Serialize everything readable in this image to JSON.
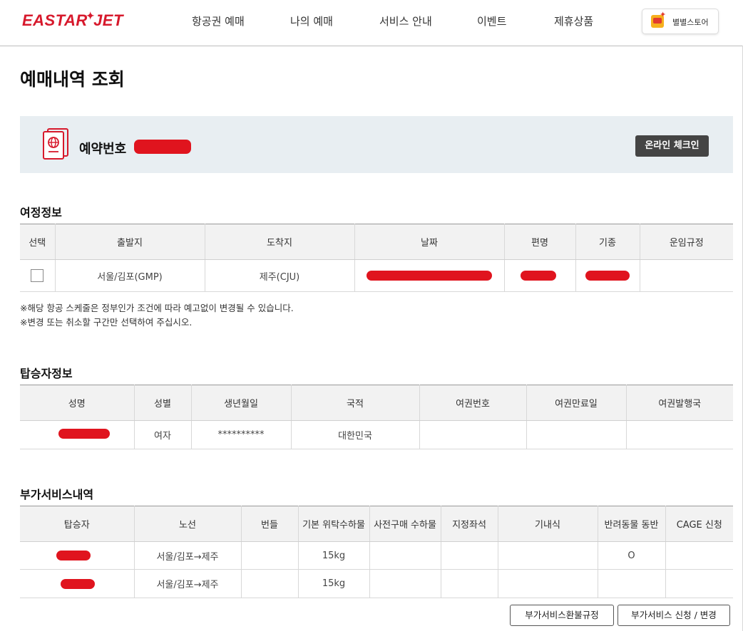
{
  "header": {
    "logo": "EASTAR JET",
    "nav": [
      "항공권 예매",
      "나의 예매",
      "서비스 안내",
      "이벤트",
      "제휴상품"
    ],
    "store_label": "별별스토어"
  },
  "page_title": "예매내역 조회",
  "booking": {
    "label": "예약번호",
    "checkin_label": "온라인 체크인"
  },
  "itinerary": {
    "title": "여정정보",
    "headers": [
      "선택",
      "출발지",
      "도착지",
      "날짜",
      "편명",
      "기종",
      "운임규정"
    ],
    "rows": [
      {
        "origin": "서울/김포(GMP)",
        "destination": "제주(CJU)"
      }
    ],
    "notes": [
      "※해당 항공 스케줄은 정부인가 조건에 따라 예고없이 변경될 수 있습니다.",
      "※변경 또는 취소할 구간만 선택하여 주십시오."
    ]
  },
  "passengers": {
    "title": "탑승자정보",
    "headers": [
      "성명",
      "성별",
      "생년월일",
      "국적",
      "여권번호",
      "여권만료일",
      "여권발행국"
    ],
    "rows": [
      {
        "gender": "여자",
        "birth": "**********",
        "nationality": "대한민국"
      }
    ]
  },
  "services": {
    "title": "부가서비스내역",
    "headers": [
      "탑승자",
      "노선",
      "번들",
      "기본 위탁수하물",
      "사전구매 수하물",
      "지정좌석",
      "기내식",
      "반려동물 동반",
      "CAGE 신청"
    ],
    "rows": [
      {
        "route": "서울/김포→제주",
        "baggage": "15kg",
        "pet": "O"
      },
      {
        "route": "서울/김포→제주",
        "baggage": "15kg",
        "pet": ""
      }
    ],
    "refund_button": "부가서비스환불규정",
    "apply_button": "부가서비스 신청 / 변경"
  },
  "colors": {
    "brand": "#d7192c",
    "redaction": "#e0141e",
    "checkin_bg": "#444444"
  }
}
